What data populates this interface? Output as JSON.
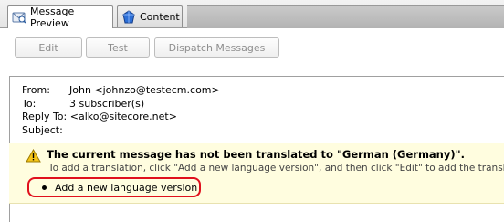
{
  "tabs": [
    {
      "label": "Message Preview",
      "icon": "envelope-preview-icon",
      "active": true
    },
    {
      "label": "Content",
      "icon": "blue-gem-icon",
      "active": false
    }
  ],
  "toolbar": {
    "edit": "Edit",
    "test": "Test",
    "dispatch": "Dispatch Messages"
  },
  "message": {
    "from_label": "From:",
    "from_value": "John <johnzo@testecm.com>",
    "to_label": "To:",
    "to_value": "3 subscriber(s)",
    "reply_label": "Reply To:",
    "reply_value": "<alko@sitecore.net>",
    "subject_label": "Subject:",
    "subject_value": ""
  },
  "warning": {
    "icon": "warning-triangle-icon",
    "title": "The current message has not been translated to \"German (Germany)\".",
    "body": "To add a translation, click \"Add a new language version\", and then click \"Edit\" to add the translated text",
    "action": "Add a new language version",
    "highlight_color": "#e0101d"
  }
}
